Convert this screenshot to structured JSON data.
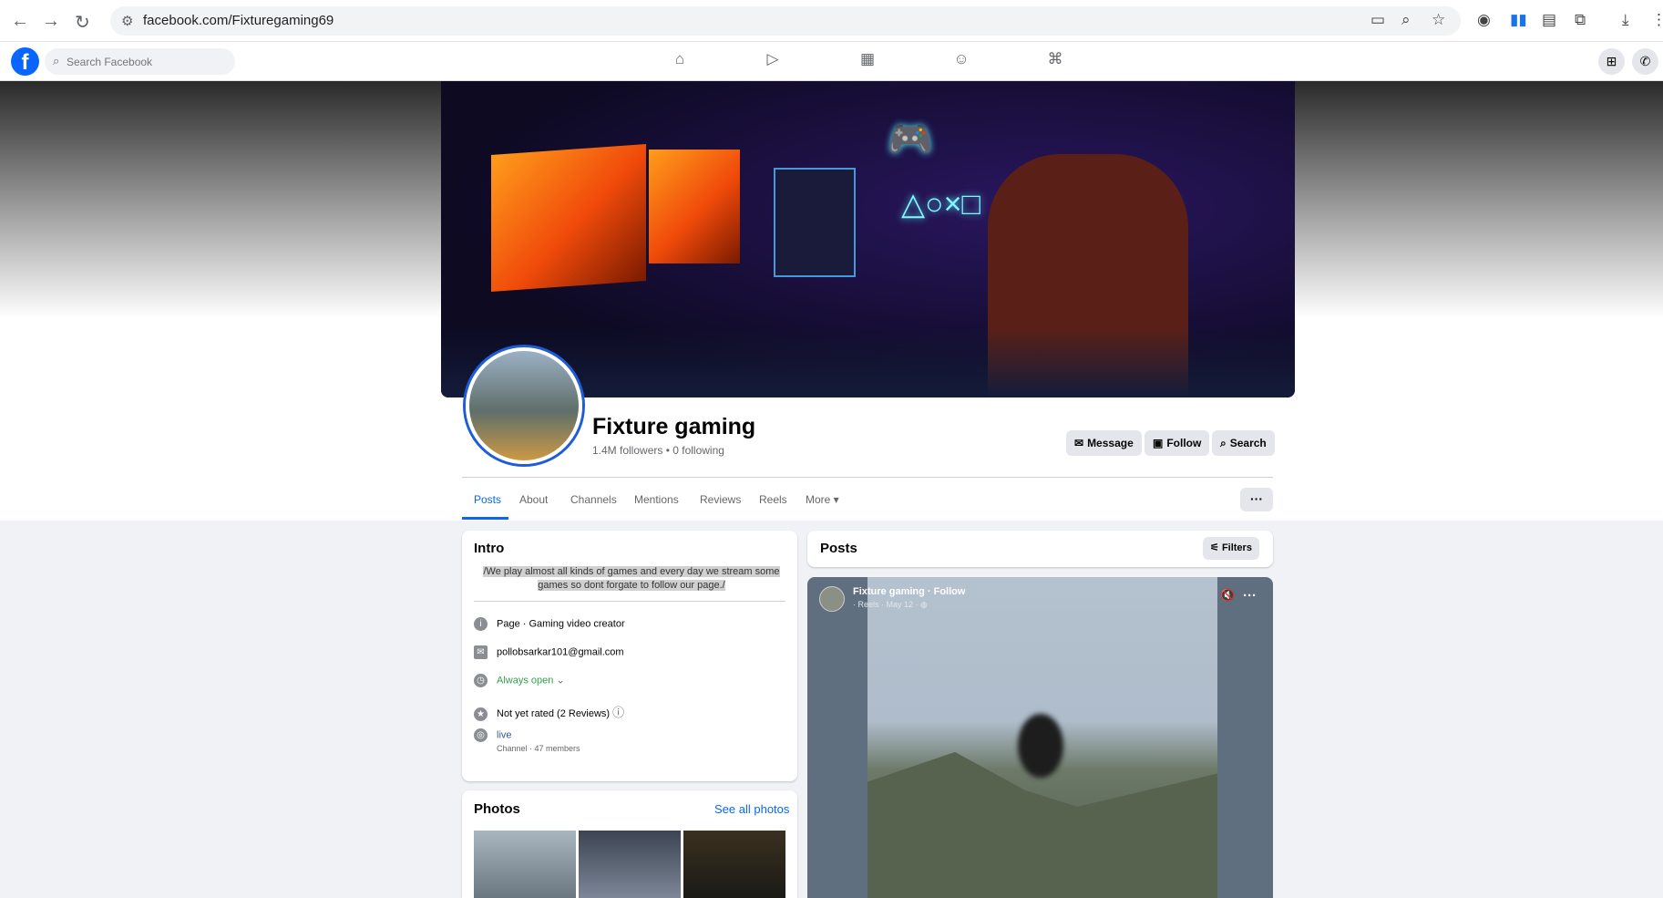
{
  "browser": {
    "url": "facebook.com/Fixturegaming69",
    "back_icon": "←",
    "forward_icon": "→",
    "reload_icon": "↻",
    "site_icon": "⚙",
    "cast_icon": "▭",
    "zoom_icon": "⌕",
    "star_icon": "☆",
    "ext_icons": [
      "◉",
      "▮▮",
      "▤",
      "⧉"
    ],
    "download_icon": "⤓",
    "menu_icon": "⋮"
  },
  "facebook": {
    "logo": "f",
    "search_placeholder": "Search Facebook",
    "search_icon": "⌕",
    "nav": [
      "⌂",
      "▷",
      "▦",
      "☺",
      "⌘"
    ],
    "menu_icon": "⊞",
    "messenger_icon": "✆"
  },
  "profile": {
    "name": "Fixture gaming",
    "meta": "1.4M followers • 0 following",
    "actions": [
      {
        "icon": "✉",
        "label": "Message"
      },
      {
        "icon": "▣",
        "label": "Follow"
      },
      {
        "icon": "⌕",
        "label": "Search"
      }
    ]
  },
  "tabs": [
    "Posts",
    "About",
    "Channels",
    "Mentions",
    "Reviews",
    "Reels",
    "More ▾"
  ],
  "more_dots": "···",
  "intro": {
    "title": "Intro",
    "bio": "/We play almost all kinds of games and every day we stream some games so dont forgate to follow our page./",
    "rows": [
      {
        "icon": "i",
        "text": "Page · Gaming video creator"
      },
      {
        "icon": "✉",
        "text": "pollobsarkar101@gmail.com"
      },
      {
        "icon": "◷",
        "text": "Always open",
        "extra": "⌄"
      },
      {
        "icon": "★",
        "text": "Not yet rated (2 Reviews)",
        "extra": "ⓘ"
      },
      {
        "icon": "◎",
        "text": "live",
        "sub": "Channel · 47 members"
      }
    ]
  },
  "photos": {
    "title": "Photos",
    "see_all": "See all photos"
  },
  "posts": {
    "title": "Posts",
    "filters_icon": "⚟",
    "filters": "Filters",
    "reel": {
      "author": "Fixture gaming · Follow",
      "meta": "· Reels · May 12 · ◍",
      "mute_icon": "🔇",
      "more_icon": "···"
    }
  },
  "colors": {
    "fb_blue": "#0866ff",
    "green": "#31a24c",
    "page_bg": "#f0f2f5"
  }
}
